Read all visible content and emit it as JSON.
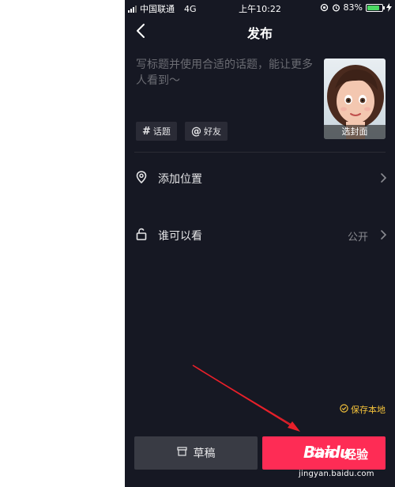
{
  "status_bar": {
    "carrier": "中国联通",
    "network": "4G",
    "time": "上午10:22",
    "battery_percent": "83%",
    "battery_level": 0.83
  },
  "nav": {
    "title": "发布",
    "back_icon": "chevron-left-icon"
  },
  "caption": {
    "placeholder": "写标题并使用合适的话题，能让更多人看到～"
  },
  "cover": {
    "label": "选封面"
  },
  "tags": [
    {
      "symbol": "#",
      "label": "话题",
      "icon": "hashtag-icon"
    },
    {
      "symbol": "@",
      "label": "好友",
      "icon": "at-icon"
    }
  ],
  "rows": {
    "location": {
      "label": "添加位置",
      "icon": "location-pin-icon"
    },
    "privacy": {
      "label": "谁可以看",
      "value": "公开",
      "icon": "unlock-icon"
    }
  },
  "save_local": {
    "label": "保存本地",
    "checked": true
  },
  "bottom": {
    "draft_label": "草稿",
    "publish_label": "发布"
  },
  "watermark": {
    "logo": "Baidu",
    "sub": "经验",
    "url": "jingyan.baidu.com"
  },
  "colors": {
    "background": "#161823",
    "accent": "#fe2c55",
    "save_local": "#f4c23a",
    "annotation_arrow": "#e8202a"
  }
}
